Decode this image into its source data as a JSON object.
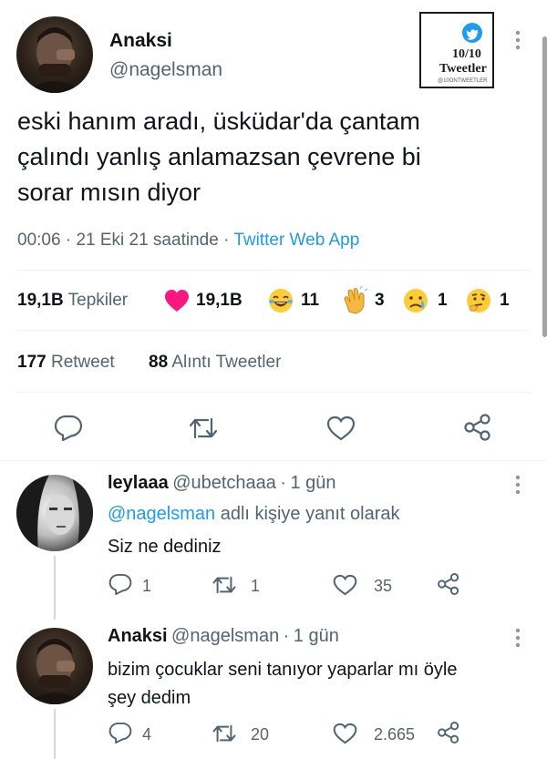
{
  "main_tweet": {
    "author_name": "Anaksi",
    "author_handle": "@nagelsman",
    "text_lines": [
      "eski hanım aradı, üsküdar'da çantam",
      "çalındı yanlış anlamazsan çevrene bi",
      "sorar mısın diyor"
    ],
    "time": "00:06",
    "date": "21 Eki 21 saatinde",
    "separator": "·",
    "source": "Twitter Web App",
    "reactions": {
      "total_count": "19,1B",
      "total_label": "Tepkiler",
      "heart_count": "19,1B",
      "laugh_count": "11",
      "clap_count": "3",
      "cry_count": "1",
      "think_count": "1"
    },
    "retweets": {
      "count": "177",
      "label": "Retweet"
    },
    "quotes": {
      "count": "88",
      "label": "Alıntı Tweetler"
    }
  },
  "badge": {
    "score": "10/10",
    "title": "Tweetler",
    "footer": "@10ONTWEETLER"
  },
  "replies": [
    {
      "name": "leylaaa",
      "handle": "@ubetchaaa",
      "time": "1 gün",
      "reply_to_handle": "@nagelsman",
      "reply_to_text": "adlı kişiye yanıt olarak",
      "text_lines": [
        "Siz ne dediniz"
      ],
      "reply_count": "1",
      "retweet_count": "1",
      "like_count": "35"
    },
    {
      "name": "Anaksi",
      "handle": "@nagelsman",
      "time": "1 gün",
      "text_lines": [
        "bizim çocuklar seni tanıyor yaparlar mı öyle",
        "şey dedim"
      ],
      "reply_count": "4",
      "retweet_count": "20",
      "like_count": "2.665"
    }
  ],
  "colors": {
    "accent": "#1d9bf0",
    "heart": "#f91880",
    "text_primary": "#0f1419",
    "text_secondary": "#536471"
  },
  "icons": [
    "reply-icon",
    "retweet-icon",
    "like-icon",
    "share-icon",
    "more-icon",
    "verified-bird-icon"
  ]
}
